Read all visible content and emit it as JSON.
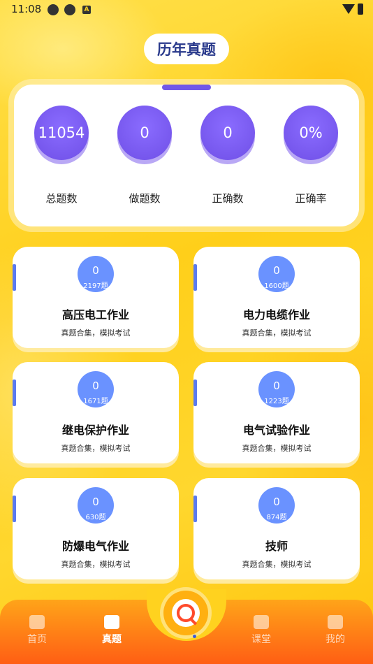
{
  "status_bar": {
    "time": "11:08",
    "icon_c": "A"
  },
  "page_title": "历年真题",
  "stats": [
    {
      "value": "11054",
      "label": "总题数"
    },
    {
      "value": "0",
      "label": "做题数"
    },
    {
      "value": "0",
      "label": "正确数"
    },
    {
      "value": "0%",
      "label": "正确率"
    }
  ],
  "categories": [
    {
      "count": "0",
      "total": "2197题",
      "name": "高压电工作业",
      "desc": "真题合集，模拟考试"
    },
    {
      "count": "0",
      "total": "1600题",
      "name": "电力电缆作业",
      "desc": "真题合集，模拟考试"
    },
    {
      "count": "0",
      "total": "1671题",
      "name": "继电保护作业",
      "desc": "真题合集，模拟考试"
    },
    {
      "count": "0",
      "total": "1223题",
      "name": "电气试验作业",
      "desc": "真题合集，模拟考试"
    },
    {
      "count": "0",
      "total": "630题",
      "name": "防爆电气作业",
      "desc": "真题合集，模拟考试"
    },
    {
      "count": "0",
      "total": "874题",
      "name": "技师",
      "desc": "真题合集，模拟考试"
    }
  ],
  "nav": {
    "items": [
      {
        "label": "首页",
        "icon": "home-icon"
      },
      {
        "label": "真题",
        "icon": "exam-icon"
      },
      {
        "label": "课堂",
        "icon": "book-icon"
      },
      {
        "label": "我的",
        "icon": "user-icon"
      }
    ],
    "center_icon": "search-icon",
    "active": "真题"
  }
}
